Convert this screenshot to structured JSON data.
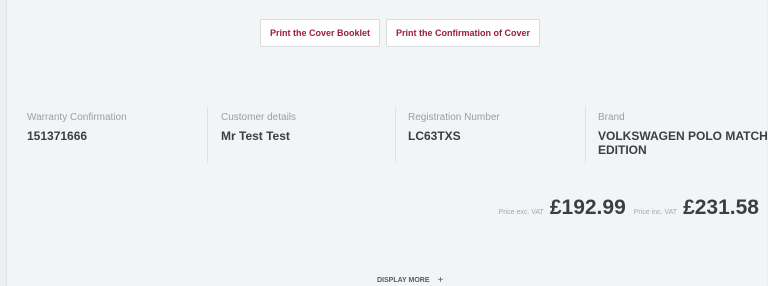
{
  "actions": {
    "print_booklet": "Print the Cover Booklet",
    "print_confirmation": "Print the Confirmation of Cover"
  },
  "details": {
    "warranty": {
      "label": "Warranty Confirmation",
      "value": "151371666"
    },
    "customer": {
      "label": "Customer details",
      "value": "Mr Test Test"
    },
    "registration": {
      "label": "Registration Number",
      "value": "LC63TXS"
    },
    "brand": {
      "label": "Brand",
      "value": "VOLKSWAGEN POLO MATCH EDITION"
    }
  },
  "pricing": {
    "exc_label": "Price exc. VAT",
    "exc_value": "£192.99",
    "inc_label": "Price inc. VAT",
    "inc_value": "£231.58"
  },
  "footer": {
    "display_more": "DISPLAY MORE",
    "plus_icon": "+"
  }
}
